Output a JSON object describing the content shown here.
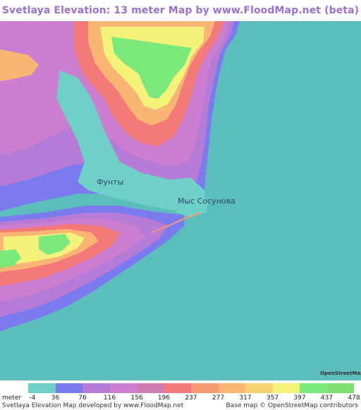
{
  "title": "Svetlaya Elevation: 13 meter Map by www.FloodMap.net (beta)",
  "places": [
    {
      "name": "Фунты"
    },
    {
      "name": "Мыс Сосунова"
    }
  ],
  "legend": {
    "unit": "meter",
    "values": [
      "-4",
      "36",
      "76",
      "116",
      "156",
      "196",
      "237",
      "277",
      "317",
      "357",
      "397",
      "437",
      "478"
    ],
    "colors": [
      "#6fd0c8",
      "#7b7bef",
      "#b57bd6",
      "#cc7ed0",
      "#d07ab0",
      "#f47a7a",
      "#f79a74",
      "#fab574",
      "#f8d270",
      "#f3f37a",
      "#7be87b",
      "#7de06f"
    ]
  },
  "footer": {
    "left": "Svetlaya Elevation Map developed by www.FloodMap.net",
    "right": "Base map © OpenStreetMap contributors"
  },
  "logo": {
    "text": "OpenStreetMap"
  },
  "colors": {
    "sea": "#5cbdbd",
    "low_ground": "#6fd0c8",
    "title": "#9b6fd6"
  }
}
